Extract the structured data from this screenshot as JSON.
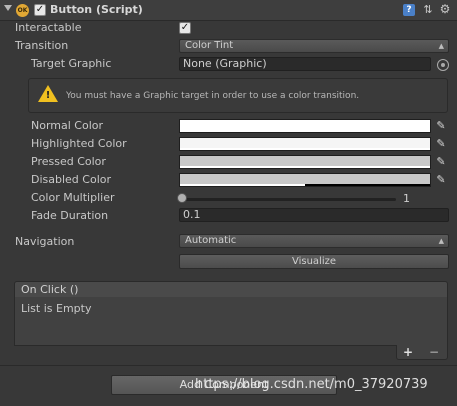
{
  "header": {
    "badge": "OK",
    "title": "Button (Script)",
    "enabled": true,
    "help_icon": "help-icon",
    "preset_icon": "preset-icon",
    "settings_icon": "gear-icon"
  },
  "fields": {
    "interactable": {
      "label": "Interactable",
      "checked": true
    },
    "transition": {
      "label": "Transition",
      "value": "Color Tint"
    },
    "target_graphic": {
      "label": "Target Graphic",
      "value": "None (Graphic)"
    },
    "warning": "You must have a Graphic target in order to use a color transition.",
    "normal_color": {
      "label": "Normal Color",
      "color": "#FFFFFF"
    },
    "highlighted_color": {
      "label": "Highlighted Color",
      "color": "#F5F5F5"
    },
    "pressed_color": {
      "label": "Pressed Color",
      "color": "#C8C8C8"
    },
    "disabled_color": {
      "label": "Disabled Color",
      "color": "#C8C8C8",
      "alpha": 0.5
    },
    "color_multiplier": {
      "label": "Color Multiplier",
      "value": "1",
      "fraction": 0
    },
    "fade_duration": {
      "label": "Fade Duration",
      "value": "0.1"
    },
    "navigation": {
      "label": "Navigation",
      "value": "Automatic"
    },
    "visualize": "Visualize"
  },
  "on_click": {
    "title": "On Click ()",
    "empty": "List is Empty",
    "add": "+",
    "remove": "−"
  },
  "add_component": "Add Component",
  "watermark": "https://blog.csdn.net/m0_37920739"
}
